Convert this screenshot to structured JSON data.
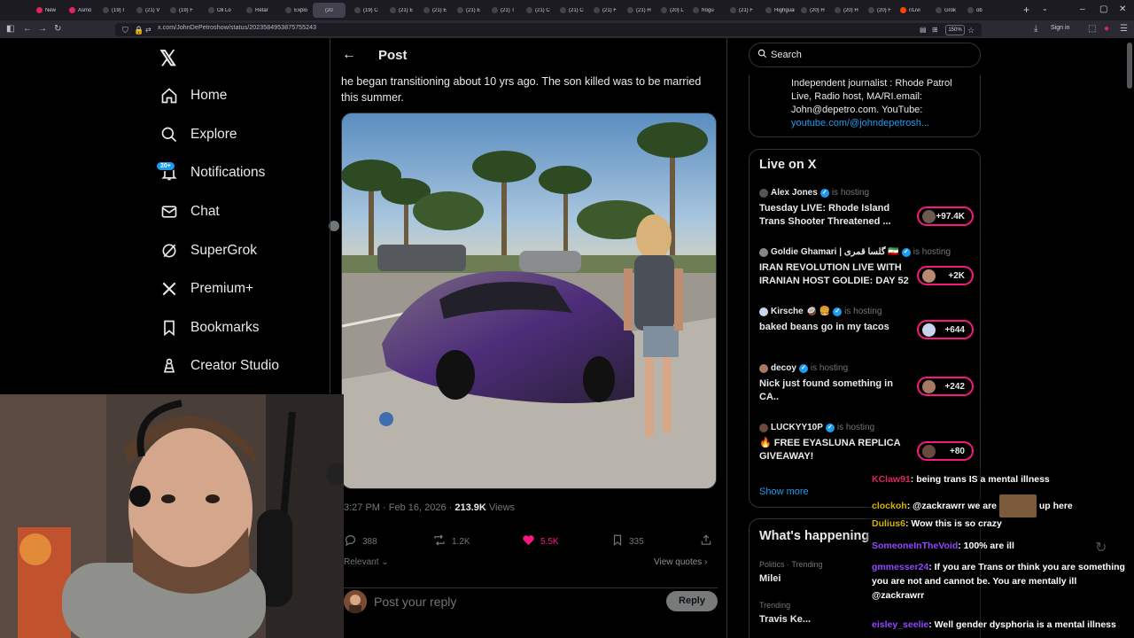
{
  "browser": {
    "tabs": [
      {
        "label": "New",
        "color": "#e0245e"
      },
      {
        "label": "Asmo",
        "color": "#e0245e"
      },
      {
        "label": "(19) I",
        "color": "#444"
      },
      {
        "label": "(21) V",
        "color": "#444"
      },
      {
        "label": "(19) F",
        "color": "#444"
      },
      {
        "label": "Oli Lo",
        "color": "#444"
      },
      {
        "label": "Retar",
        "color": "#444"
      },
      {
        "label": "Explo",
        "color": "#444"
      },
      {
        "label": "(20",
        "color": "#444"
      },
      {
        "label": "(19) C",
        "color": "#444"
      },
      {
        "label": "(21) E",
        "color": "#444"
      },
      {
        "label": "(21) E",
        "color": "#444"
      },
      {
        "label": "(21) E",
        "color": "#444"
      },
      {
        "label": "(21) T",
        "color": "#444"
      },
      {
        "label": "(21) C",
        "color": "#444"
      },
      {
        "label": "(21) C",
        "color": "#444"
      },
      {
        "label": "(21) F",
        "color": "#444"
      },
      {
        "label": "(21) H",
        "color": "#444"
      },
      {
        "label": "(20) L",
        "color": "#444"
      },
      {
        "label": "frogu",
        "color": "#444"
      },
      {
        "label": "(21) F",
        "color": "#444"
      },
      {
        "label": "Highguar",
        "color": "#444"
      },
      {
        "label": "(20) H",
        "color": "#444"
      },
      {
        "label": "(20) H",
        "color": "#444"
      },
      {
        "label": "(20) F",
        "color": "#444"
      },
      {
        "label": "r/Livi",
        "color": "#ff4500"
      },
      {
        "label": "Grok",
        "color": "#444"
      },
      {
        "label": "ob",
        "color": "#444"
      }
    ],
    "url": "x.com/JohnDePetroshow/status/2023584953875755243",
    "zoom": "150%",
    "signin": "Sign in"
  },
  "nav": {
    "items": [
      {
        "label": "Home",
        "icon": "home-icon",
        "glyph": "⌂"
      },
      {
        "label": "Explore",
        "icon": "search-icon",
        "glyph": "⚲"
      },
      {
        "label": "Notifications",
        "icon": "bell-icon",
        "glyph": "🔔"
      },
      {
        "label": "Chat",
        "icon": "mail-icon",
        "glyph": "✉"
      },
      {
        "label": "SuperGrok",
        "icon": "grok-icon",
        "glyph": "⊘"
      },
      {
        "label": "Premium+",
        "icon": "x-icon",
        "glyph": "𝕏"
      },
      {
        "label": "Bookmarks",
        "icon": "bookmark-icon",
        "glyph": "🔖"
      },
      {
        "label": "Creator Studio",
        "icon": "creator-icon",
        "glyph": "♙"
      }
    ],
    "notif_badge": "20+"
  },
  "post": {
    "header": "Post",
    "text": "he began transitioning about 10 yrs ago. The son killed was to be married this summer.",
    "timestamp": "3:27 PM · Feb 16, 2026 ·",
    "views_count": "213.9K",
    "views_label": "Views",
    "replies": "388",
    "reposts": "1.2K",
    "likes": "5.5K",
    "bookmarks": "335",
    "sort_label": "Relevant",
    "view_quotes": "View quotes",
    "reply_placeholder": "Post your reply",
    "reply_button": "Reply"
  },
  "sidebar": {
    "search_placeholder": "Search",
    "bio": "Independent journalist : Rhode Patrol Live, Radio host, MA/RI.email: John@depetro.com. YouTube:",
    "bio_link": "youtube.com/@johndepetrosh...",
    "live_title": "Live on X",
    "hosting_label": "is hosting",
    "live": [
      {
        "host": "Alex Jones",
        "title": "Tuesday LIVE: Rhode Island Trans Shooter Threatened ...",
        "count": "+97.4K",
        "avatar_color": "#6b5a50"
      },
      {
        "host": "Goldie Ghamari | گلسا قمری 🇮🇷",
        "title": "IRAN REVOLUTION LIVE WITH IRANIAN HOST GOLDIE: DAY 52",
        "count": "+2K",
        "avatar_color": "#b88a70"
      },
      {
        "host": "Kirsche 🥥 🍔",
        "title": "baked beans go in my tacos",
        "count": "+644",
        "avatar_color": "#c9d4ee"
      },
      {
        "host": "decoy",
        "title": "Nick just found something in CA..",
        "count": "+242",
        "avatar_color": "#a67a62"
      },
      {
        "host": "LUCKYY10P",
        "title": "🔥 FREE EYASLUNA REPLICA GIVEAWAY!",
        "count": "+80",
        "avatar_color": "#6a4a3e"
      }
    ],
    "show_more": "Show more",
    "happening_title": "What's happening",
    "trends": [
      {
        "meta": "Politics · Trending",
        "name": "Milei"
      },
      {
        "meta": "Trending",
        "name": "Travis Ke..."
      }
    ]
  },
  "chat": [
    {
      "user": "KClaw91",
      "color": "#e0245e",
      "msg": "being trans IS a mental illness"
    },
    {
      "user": "clockoh",
      "color": "#d4b300",
      "msg": "@zackrawrr we are",
      "msg2": "up here"
    },
    {
      "user": "Dulius6",
      "color": "#d4b300",
      "msg": "Wow this is so crazy"
    },
    {
      "user": "SomeoneInTheVoid",
      "color": "#9147ff",
      "msg": "100% are ill"
    },
    {
      "user": "gmmesser24",
      "color": "#9147ff",
      "msg": "If you are Trans or think you are something you are not and cannot be. You are mentally ill @zackrawrr"
    },
    {
      "user": "eisley_seelie",
      "color": "#9147ff",
      "msg": "Well gender dysphoria is a mental illness"
    }
  ]
}
